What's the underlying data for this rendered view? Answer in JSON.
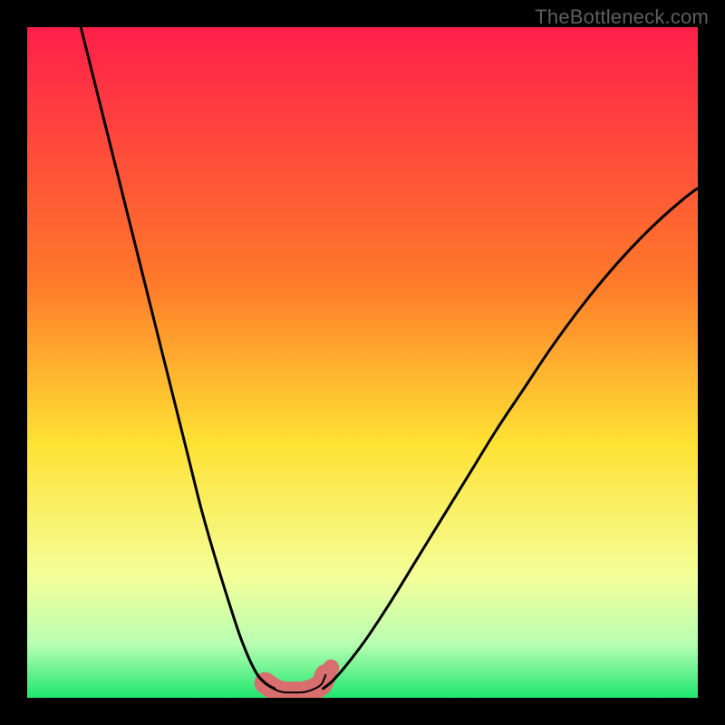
{
  "watermark": "TheBottleneck.com",
  "colors": {
    "frame": "#000000",
    "watermark_text": "#5e5e5e",
    "gradient_top": "#ff1f4a",
    "gradient_mid1": "#ff7a2a",
    "gradient_mid2": "#ffe233",
    "gradient_bottom1": "#f4ff9a",
    "gradient_bottom2": "#b8ffb2",
    "gradient_bottom3": "#1ee66f",
    "curve_stroke": "#000000",
    "highlight": "#d96e6e"
  },
  "chart_data": {
    "type": "line",
    "title": "",
    "xlabel": "",
    "ylabel": "",
    "xlim": [
      0,
      100
    ],
    "ylim": [
      0,
      100
    ],
    "series": [
      {
        "name": "left-arm",
        "x": [
          8,
          10,
          12,
          14,
          16,
          18,
          20,
          22,
          24,
          26,
          28,
          30,
          32,
          34,
          35.5,
          37
        ],
        "y": [
          100,
          92,
          84,
          76,
          68,
          60,
          52,
          44,
          36,
          28,
          21,
          14.5,
          8.5,
          4,
          2.2,
          1.3
        ]
      },
      {
        "name": "right-arm",
        "x": [
          44,
          46,
          50,
          54,
          58,
          62,
          66,
          70,
          74,
          78,
          82,
          86,
          90,
          94,
          98,
          100
        ],
        "y": [
          1.3,
          3,
          8,
          14,
          20.5,
          27,
          33.5,
          40,
          46,
          52,
          57.5,
          62.5,
          67,
          71,
          74.5,
          76
        ]
      },
      {
        "name": "bottleneck-valley-highlight",
        "x": [
          35.5,
          36.5,
          37.5,
          38.5,
          39.5,
          40.5,
          41.5,
          42.5,
          43.5,
          44,
          44.5
        ],
        "y": [
          2.2,
          1.5,
          1.0,
          0.8,
          0.8,
          0.8,
          0.9,
          1.2,
          1.7,
          2.2,
          3.4
        ]
      }
    ],
    "highlight_end_dot": {
      "x": 45.3,
      "y": 4.5
    }
  }
}
